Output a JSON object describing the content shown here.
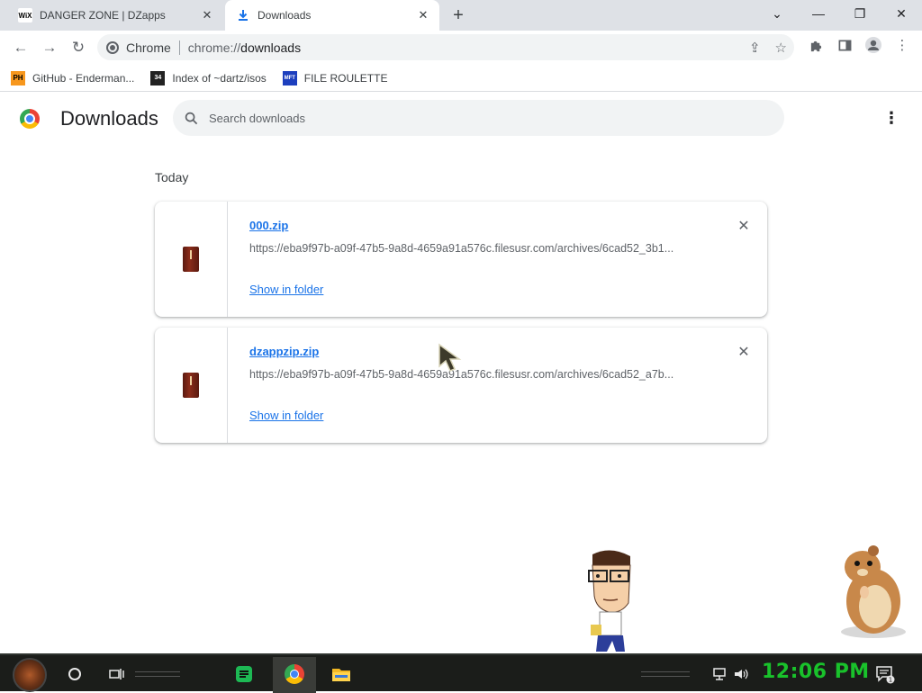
{
  "tabs": [
    {
      "favicon": "WiX",
      "title": "DANGER ZONE | DZapps"
    },
    {
      "favicon": "download-icon",
      "title": "Downloads"
    }
  ],
  "toolbar": {
    "site_name": "Chrome",
    "url_scheme": "chrome://",
    "url_host": "downloads"
  },
  "bookmarks": [
    {
      "favicon": "PH",
      "label": "GitHub - Enderman..."
    },
    {
      "favicon": "34",
      "label": "Index of ~dartz/isos"
    },
    {
      "favicon": "MFT",
      "label": "FILE ROULETTE"
    }
  ],
  "downloads_page": {
    "title": "Downloads",
    "search_placeholder": "Search downloads",
    "section_label": "Today",
    "items": [
      {
        "filename": "000.zip",
        "url": "https://eba9f97b-a09f-47b5-9a8d-4659a91a576c.filesusr.com/archives/6cad52_3b1...",
        "action": "Show in folder"
      },
      {
        "filename": "dzappzip.zip",
        "url": "https://eba9f97b-a09f-47b5-9a8d-4659a91a576c.filesusr.com/archives/6cad52_a7b...",
        "action": "Show in folder"
      }
    ]
  },
  "taskbar": {
    "clock": "12:06 PM",
    "notification_count": "1",
    "clock_color": "#19c22b"
  },
  "colors": {
    "link": "#1a73e8",
    "tabstrip": "#dee1e6",
    "taskbar": "#1b1d1a"
  }
}
